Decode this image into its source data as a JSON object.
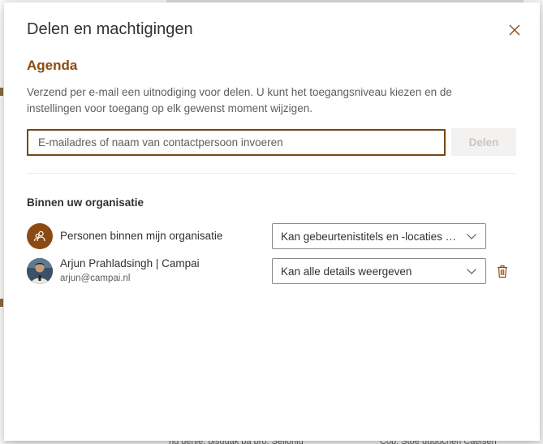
{
  "background": {
    "bottom_text_left": "ng genie, pisugak pa pro, Selionlu",
    "bottom_text_right": "Cop. Stoe gugucnen Caelsen"
  },
  "dialog": {
    "title": "Delen en machtigingen",
    "close_icon": "close-icon",
    "section_title": "Agenda",
    "description": "Verzend per e-mail een uitnodiging voor delen. U kunt het toegangsniveau kiezen en de instellingen voor toegang op elk gewenst moment wijzigen.",
    "email_placeholder": "E-mailadres of naam van contactpersoon invoeren",
    "email_value": "",
    "share_label": "Delen",
    "org_heading": "Binnen uw organisatie",
    "people": [
      {
        "name": "Personen binnen mijn organisatie",
        "email": "",
        "avatar": "people-icon",
        "permission": "Kan gebeurtenistitels en -locaties weergeven",
        "removable": false
      },
      {
        "name": "Arjun Prahladsingh | Campai",
        "email": "arjun@campai.nl",
        "avatar": "user-photo",
        "permission": "Kan alle details weergeven",
        "removable": true
      }
    ]
  },
  "colors": {
    "accent": "#8a4b12",
    "input_border": "#7a4513",
    "text": "#323130",
    "muted": "#605e5c"
  }
}
